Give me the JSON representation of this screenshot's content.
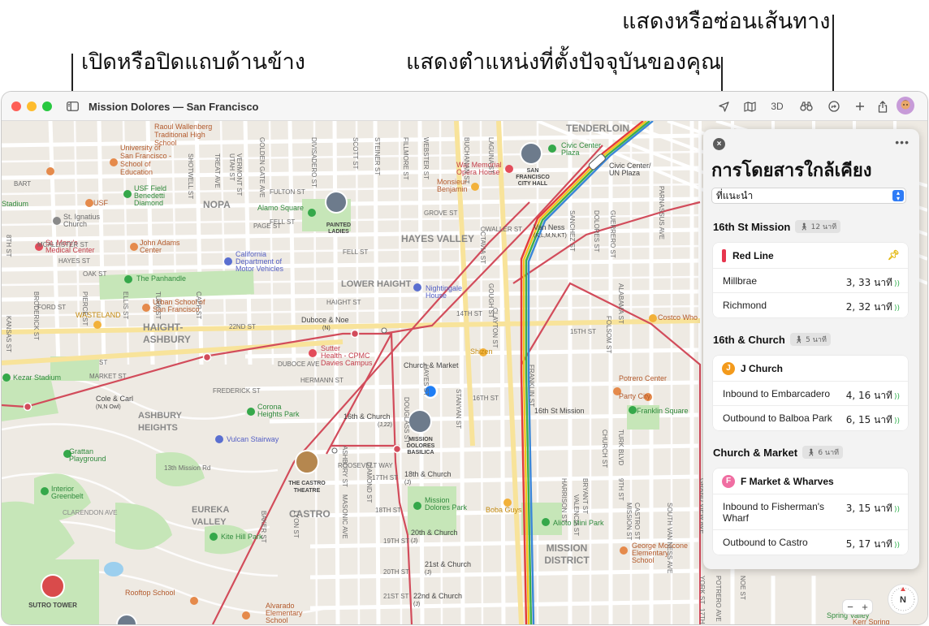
{
  "callouts": {
    "sidebar": "เปิดหรือปิดแถบด้านข้าง",
    "location": "แสดงตำแหน่งที่ตั้งปัจจุบันของคุณ",
    "directions": "แสดงหรือซ่อนเส้นทาง"
  },
  "window": {
    "title": "Mission Dolores — San Francisco",
    "toolbar": {
      "view_3d": "3D"
    }
  },
  "colors": {
    "red_line": "#e7364e",
    "j_church": "#f39a1c",
    "f_market": "#f06ea2",
    "bart_red": "#e33b3b",
    "bart_yellow": "#f2c31b",
    "bart_green": "#3cae4a",
    "bart_blue": "#3a86d8",
    "muni_route": "#d24c5b",
    "park": "#bfe3b3",
    "location": "#1f7ef5"
  },
  "icons": [
    "sidebar-icon",
    "location-arrow-icon",
    "map-icon",
    "binoculars-icon",
    "directions-icon",
    "plus-icon",
    "share-icon",
    "avatar-icon",
    "close-icon",
    "more-icon",
    "pin-icon",
    "walk-icon",
    "realtime-icon"
  ],
  "map": {
    "labels": [
      "Raoul Wallenberg",
      "Traditional High",
      "School",
      "University of",
      "San Francisco -",
      "School of",
      "Education",
      "USF",
      "USF Field",
      "Benedetti",
      "Diamond",
      "St. Ignatius",
      "Church",
      "St. Mary's",
      "Medical Center",
      "John Adams",
      "Center",
      "The Panhandle",
      "WASTELAND",
      "Urban School of",
      "San Francisco",
      "HAIGHT-",
      "ASHBURY",
      "Kezar Stadium",
      "Cole & Carl",
      "(N,N Owl)",
      "ASHBURY",
      "HEIGHTS",
      "Grattan",
      "Playground",
      "Interior",
      "Greenbelt",
      "CLARENDON AVE",
      "SUTRO TOWER",
      "Rooftop School",
      "Alvarado",
      "Elementary",
      "School",
      "Kite Hill Park",
      "EUREKA",
      "VALLEY",
      "CASTRO",
      "THE CASTRO",
      "THEATRE",
      "Vulcan Stairway",
      "Corona",
      "Heights Park",
      "16th & Church",
      "(J,22)",
      "MISSION",
      "DOLORES",
      "BASILICA",
      "18th & Church",
      "(J)",
      "Mission",
      "Dolores Park",
      "20th & Church",
      "(J)",
      "21st & Church",
      "(J)",
      "22nd & Church",
      "(J)",
      "Boba Guys",
      "Alioto Mini Park",
      "MISSION",
      "DISTRICT",
      "George Moscone",
      "Elementary",
      "School",
      "Church & Market",
      "Shizen",
      "Sutter",
      "Health - CPMC",
      "Davies Campus",
      "Duboce & Noe",
      "(N)",
      "LOWER HAIGHT",
      "Nightingale",
      "House",
      "HAYES VALLEY",
      "California",
      "Department of",
      "Motor Vehicles",
      "NOPA",
      "Alamo Square",
      "PAINTED",
      "LADIES",
      "Monsieur",
      "Benjamin",
      "War Memorial",
      "Opera House",
      "SAN",
      "FRANCISCO",
      "CITY HALL",
      "Civic Center",
      "Plaza",
      "Civic Center/",
      "UN Plaza",
      "TENDERLOIN",
      "Van Ness",
      "(K,L,M,N,KT)",
      "16th St Mission",
      "Potrero Center",
      "Party City",
      "Franklin Square",
      "Costco Who",
      "Spring Valley",
      "Stadium",
      "Kerr Spring",
      "FULTON ST",
      "FELL ST",
      "OAK ST",
      "FELL ST",
      "HAYES ST",
      "GROVE ST",
      "PAGE ST",
      "HAIGHT ST",
      "WALLER ST",
      "DUBOCE AVE",
      "HERMANN ST",
      "14TH ST",
      "15TH ST",
      "16TH ST",
      "17TH ST",
      "18TH ST",
      "19TH ST",
      "20TH ST",
      "21ST ST",
      "22ND ST",
      "MARKET ST",
      "FREDERICK ST",
      "ROOSEVELT WAY",
      "FORD ST",
      "MCALLISTER ST",
      "GOLDEN GATE AVE",
      "DIVISADERO ST",
      "SCOTT ST",
      "STEINER ST",
      "FILLMORE ST",
      "WEBSTER ST",
      "BUCHANAN ST",
      "LAGUNA ST",
      "OCTAVIA ST",
      "GOUGH ST",
      "FRANKLIN ST",
      "VALENCIA ST",
      "MISSION ST",
      "SOUTH VAN NESS AVE",
      "FOLSOM ST",
      "HARRISON ST",
      "BRYANT ST",
      "ALABAMA ST",
      "YORK ST",
      "POTRERO AVE",
      "NOE ST",
      "SANCHEZ ST",
      "DOLORES ST",
      "GUERRERO ST",
      "CASTRO ST",
      "DIAMOND ST",
      "DOUGLASS ST",
      "STANYAN ST",
      "CLAYTON ST",
      "ASHBURY ST",
      "MASONIC AVE",
      "LYON ST",
      "BAKER ST",
      "BRODERICK ST",
      "PIERCE ST",
      "ELLIS ST",
      "TURK ST",
      "CAPP ST",
      "SHOTWELL ST",
      "TREAT AVE",
      "UTAH ST",
      "VERMONT ST",
      "KANSAS ST",
      "8TH ST",
      "9TH ST",
      "CHURCH ST",
      "TURK BLVD",
      "GRAND VIEW AVE",
      "PARNASSUS AVE",
      "17TH ST",
      "HAYES ST",
      "BART",
      "13th Mission Rd",
      "ST"
    ]
  },
  "panel": {
    "title": "การโดยสารใกล้เคียง",
    "filter": "ที่แนะนำ",
    "stops": [
      {
        "name": "16th St Mission",
        "walk": "12 นาที",
        "lines": [
          {
            "name": "Red Line",
            "badge": "",
            "departures": [
              {
                "destination": "Millbrae",
                "times": "3, 33 นาที"
              },
              {
                "destination": "Richmond",
                "times": "2, 32 นาที"
              }
            ]
          }
        ]
      },
      {
        "name": "16th & Church",
        "walk": "5 นาที",
        "lines": [
          {
            "name": "J Church",
            "badge": "J",
            "departures": [
              {
                "destination": "Inbound to Embarcadero",
                "times": "4, 16 นาที"
              },
              {
                "destination": "Outbound to Balboa Park",
                "times": "6, 15 นาที"
              }
            ]
          }
        ]
      },
      {
        "name": "Church & Market",
        "walk": "6 นาที",
        "lines": [
          {
            "name": "F Market & Wharves",
            "badge": "F",
            "departures": [
              {
                "destination": "Inbound to Fisherman's Wharf",
                "times": "3, 15 นาที"
              },
              {
                "destination": "Outbound to Castro",
                "times": "5, 17 นาที"
              }
            ]
          }
        ]
      }
    ]
  },
  "controls": {
    "zoom_out": "−",
    "zoom_in": "+",
    "compass": "N"
  }
}
